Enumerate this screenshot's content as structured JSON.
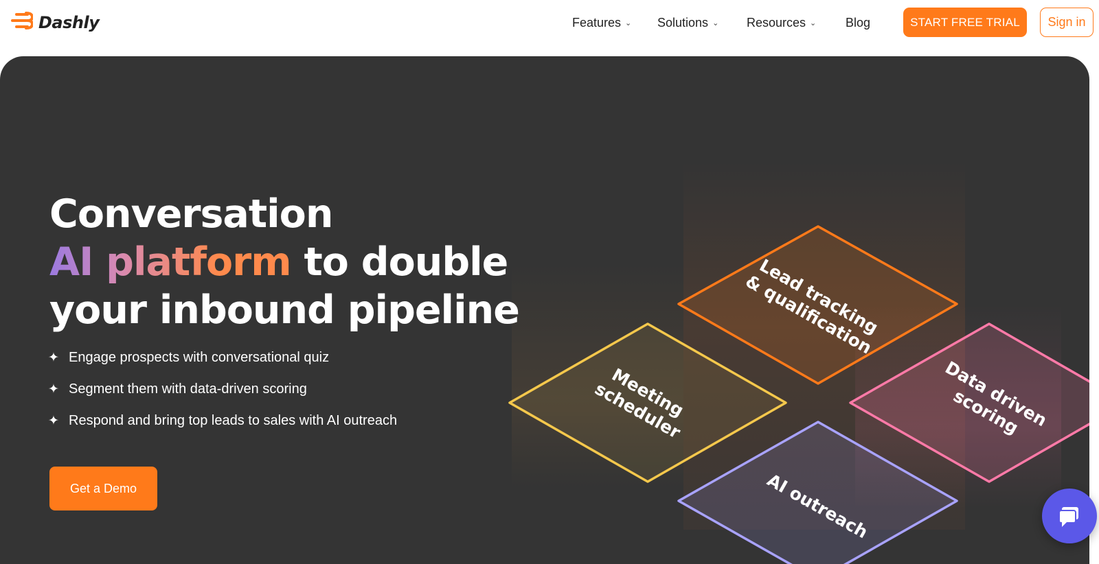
{
  "header": {
    "brand": "Dashly",
    "nav": [
      {
        "label": "Features",
        "has_dropdown": true
      },
      {
        "label": "Solutions",
        "has_dropdown": true
      },
      {
        "label": "Resources",
        "has_dropdown": true
      },
      {
        "label": "Blog",
        "has_dropdown": false
      }
    ],
    "trial_button": "START FREE TRIAL",
    "signin_button": "Sign in"
  },
  "hero": {
    "headline_line1": "Conversation",
    "headline_highlight": "AI platform",
    "headline_line2_rest": " to double",
    "headline_line3": "your inbound pipeline",
    "bullets": [
      "Engage prospects with conversational quiz",
      "Segment them with data-driven scoring",
      "Respond and bring top leads to sales with AI outreach"
    ],
    "cta": "Get a Demo"
  },
  "diagram": {
    "tiles": [
      {
        "label_lines": [
          "Lead tracking",
          "& qualification"
        ],
        "color": "#ff7a1a"
      },
      {
        "label_lines": [
          "Meeting",
          "scheduler"
        ],
        "color": "#f5c84c"
      },
      {
        "label_lines": [
          "Data driven",
          "scoring"
        ],
        "color": "#ff7aa8"
      },
      {
        "label_lines": [
          "AI outreach"
        ],
        "color": "#a9a3ff"
      }
    ]
  },
  "icons": {
    "logo": "dashly-logo-icon",
    "chevron": "chevron-down-icon",
    "bullet": "sparkle-icon",
    "chat": "chat-icon"
  },
  "colors": {
    "accent": "#ff7a1a",
    "hero_bg": "#343434",
    "chat_fab": "#5b58e8"
  }
}
